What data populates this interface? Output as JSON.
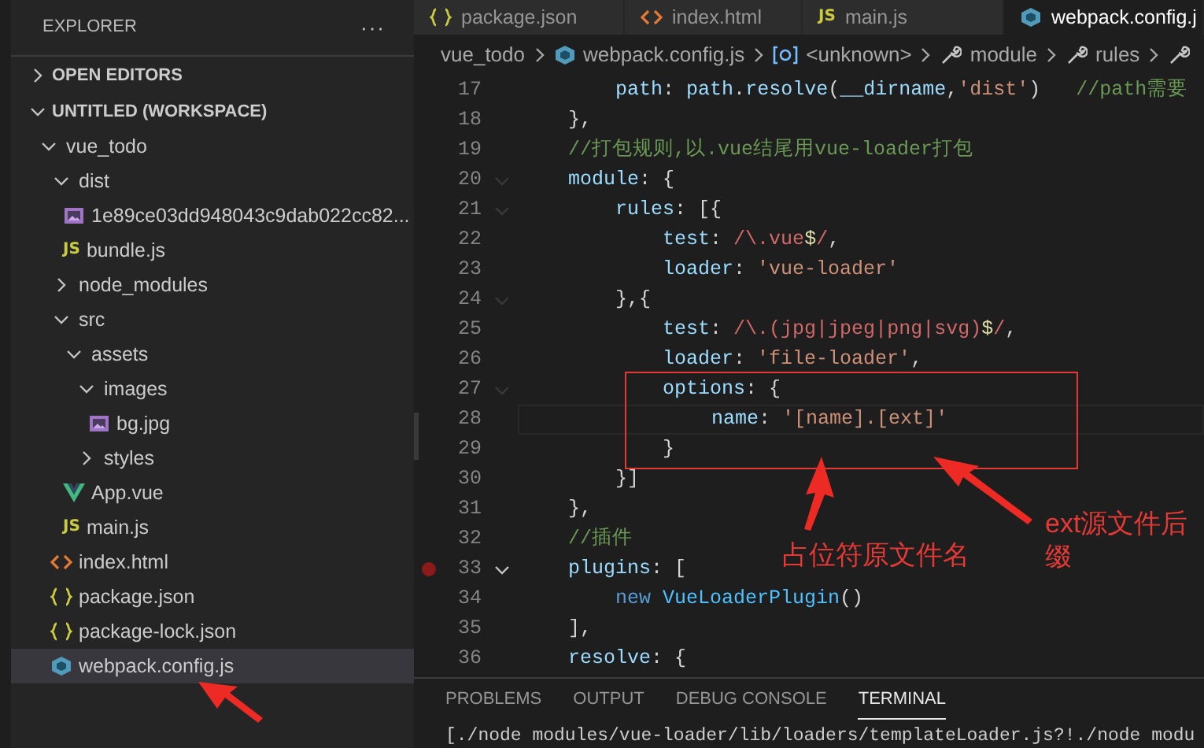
{
  "sidebar": {
    "title": "EXPLORER",
    "more": "···",
    "sections": [
      {
        "label": "OPEN EDITORS",
        "expanded": false
      },
      {
        "label": "UNTITLED (WORKSPACE)",
        "expanded": true
      }
    ],
    "tree": [
      {
        "name": "vue_todo",
        "kind": "folder",
        "expanded": true,
        "selected": false,
        "children": [
          {
            "name": "dist",
            "kind": "folder",
            "expanded": true,
            "selected": false,
            "children": [
              {
                "name": "1e89ce03dd948043c9dab022cc82...",
                "kind": "image",
                "selected": false
              },
              {
                "name": "bundle.js",
                "kind": "js",
                "icon_text": "JS",
                "selected": false
              }
            ]
          },
          {
            "name": "node_modules",
            "kind": "folder",
            "expanded": false,
            "selected": false
          },
          {
            "name": "src",
            "kind": "folder",
            "expanded": true,
            "selected": false,
            "children": [
              {
                "name": "assets",
                "kind": "folder",
                "expanded": true,
                "selected": false,
                "children": [
                  {
                    "name": "images",
                    "kind": "folder",
                    "expanded": true,
                    "selected": false,
                    "children": [
                      {
                        "name": "bg.jpg",
                        "kind": "image",
                        "selected": false
                      }
                    ]
                  },
                  {
                    "name": "styles",
                    "kind": "folder",
                    "expanded": false,
                    "selected": false
                  }
                ]
              },
              {
                "name": "App.vue",
                "kind": "vue",
                "selected": false
              },
              {
                "name": "main.js",
                "kind": "js",
                "icon_text": "JS",
                "selected": false
              }
            ]
          },
          {
            "name": "index.html",
            "kind": "html",
            "selected": false
          },
          {
            "name": "package.json",
            "kind": "json",
            "selected": false
          },
          {
            "name": "package-lock.json",
            "kind": "json",
            "selected": false
          },
          {
            "name": "webpack.config.js",
            "kind": "webpack",
            "selected": true
          }
        ]
      }
    ]
  },
  "tabs": [
    {
      "label": "package.json",
      "kind": "json",
      "selected": false
    },
    {
      "label": "index.html",
      "kind": "html",
      "selected": false
    },
    {
      "label": "main.js",
      "kind": "js",
      "icon_text": "JS",
      "selected": false
    },
    {
      "label": "webpack.config.j",
      "kind": "webpack",
      "selected": true
    }
  ],
  "breadcrumb": [
    {
      "label": "vue_todo",
      "kind": "folder"
    },
    {
      "label": "webpack.config.js",
      "kind": "webpack"
    },
    {
      "label": "<unknown>",
      "kind": "symbol"
    },
    {
      "label": "module",
      "kind": "property"
    },
    {
      "label": "rules",
      "kind": "property"
    },
    {
      "kind": "property"
    }
  ],
  "code_lines": [
    {
      "number": "17",
      "fold_arrow": false,
      "breakpoint": false,
      "current": false,
      "tokens": [
        {
          "kind": "key",
          "text": "        path"
        },
        {
          "kind": "punct",
          "text": ": "
        },
        {
          "kind": "key",
          "text": "path"
        },
        {
          "kind": "punct",
          "text": "."
        },
        {
          "kind": "key",
          "text": "resolve"
        },
        {
          "kind": "punct",
          "text": "("
        },
        {
          "kind": "key",
          "text": "__dirname"
        },
        {
          "kind": "punct",
          "text": ","
        },
        {
          "kind": "string",
          "text": "'dist'"
        },
        {
          "kind": "punct",
          "text": ")   "
        },
        {
          "kind": "comment",
          "text": "//path需要"
        }
      ]
    },
    {
      "number": "18",
      "fold_arrow": false,
      "breakpoint": false,
      "current": false,
      "tokens": [
        {
          "kind": "punct",
          "text": "    },"
        }
      ]
    },
    {
      "number": "19",
      "fold_arrow": false,
      "breakpoint": false,
      "current": false,
      "tokens": [
        {
          "kind": "comment",
          "text": "    //打包规则,以.vue结尾用vue-loader打包"
        }
      ]
    },
    {
      "number": "20",
      "fold_arrow": true,
      "breakpoint": false,
      "current": false,
      "tokens": [
        {
          "kind": "key",
          "text": "    module"
        },
        {
          "kind": "punct",
          "text": ": {"
        }
      ]
    },
    {
      "number": "21",
      "fold_arrow": true,
      "breakpoint": false,
      "current": false,
      "tokens": [
        {
          "kind": "key",
          "text": "        rules"
        },
        {
          "kind": "punct",
          "text": ": [{"
        }
      ]
    },
    {
      "number": "22",
      "fold_arrow": false,
      "breakpoint": false,
      "current": false,
      "tokens": [
        {
          "kind": "key",
          "text": "            test"
        },
        {
          "kind": "punct",
          "text": ": "
        },
        {
          "kind": "regex",
          "text": "/\\.vue"
        },
        {
          "kind": "anchor",
          "text": "$"
        },
        {
          "kind": "regex",
          "text": "/"
        },
        {
          "kind": "punct",
          "text": ","
        }
      ]
    },
    {
      "number": "23",
      "fold_arrow": false,
      "breakpoint": false,
      "current": false,
      "tokens": [
        {
          "kind": "key",
          "text": "            loader"
        },
        {
          "kind": "punct",
          "text": ": "
        },
        {
          "kind": "string",
          "text": "'vue-loader'"
        }
      ]
    },
    {
      "number": "24",
      "fold_arrow": true,
      "breakpoint": false,
      "current": false,
      "tokens": [
        {
          "kind": "punct",
          "text": "        },{"
        }
      ]
    },
    {
      "number": "25",
      "fold_arrow": false,
      "breakpoint": false,
      "current": false,
      "tokens": [
        {
          "kind": "key",
          "text": "            test"
        },
        {
          "kind": "punct",
          "text": ": "
        },
        {
          "kind": "regex",
          "text": "/\\.(jpg|jpeg|png|svg)"
        },
        {
          "kind": "anchor",
          "text": "$"
        },
        {
          "kind": "regex",
          "text": "/"
        },
        {
          "kind": "punct",
          "text": ","
        }
      ]
    },
    {
      "number": "26",
      "fold_arrow": false,
      "breakpoint": false,
      "current": false,
      "tokens": [
        {
          "kind": "key",
          "text": "            loader"
        },
        {
          "kind": "punct",
          "text": ": "
        },
        {
          "kind": "string",
          "text": "'file-loader'"
        },
        {
          "kind": "punct",
          "text": ","
        }
      ]
    },
    {
      "number": "27",
      "fold_arrow": true,
      "breakpoint": false,
      "current": false,
      "tokens": [
        {
          "kind": "key",
          "text": "            options"
        },
        {
          "kind": "punct",
          "text": ": {"
        }
      ]
    },
    {
      "number": "28",
      "fold_arrow": false,
      "breakpoint": false,
      "current": true,
      "tokens": [
        {
          "kind": "key",
          "text": "                name"
        },
        {
          "kind": "punct",
          "text": ": "
        },
        {
          "kind": "string",
          "text": "'[name].[ext]'"
        }
      ]
    },
    {
      "number": "29",
      "fold_arrow": false,
      "breakpoint": false,
      "current": false,
      "tokens": [
        {
          "kind": "punct",
          "text": "            }"
        }
      ]
    },
    {
      "number": "30",
      "fold_arrow": false,
      "breakpoint": false,
      "current": false,
      "tokens": [
        {
          "kind": "punct",
          "text": "        }]"
        }
      ]
    },
    {
      "number": "31",
      "fold_arrow": false,
      "breakpoint": false,
      "current": false,
      "tokens": [
        {
          "kind": "punct",
          "text": "    },"
        }
      ]
    },
    {
      "number": "32",
      "fold_arrow": false,
      "breakpoint": false,
      "current": false,
      "tokens": [
        {
          "kind": "comment",
          "text": "    //插件"
        }
      ]
    },
    {
      "number": "33",
      "fold_arrow": true,
      "breakpoint": true,
      "current": false,
      "tokens": [
        {
          "kind": "key",
          "text": "    plugins"
        },
        {
          "kind": "punct",
          "text": ": ["
        }
      ]
    },
    {
      "number": "34",
      "fold_arrow": false,
      "breakpoint": false,
      "current": false,
      "tokens": [
        {
          "kind": "keyword",
          "text": "        new "
        },
        {
          "kind": "class",
          "text": "VueLoaderPlugin"
        },
        {
          "kind": "punct",
          "text": "()"
        }
      ]
    },
    {
      "number": "35",
      "fold_arrow": false,
      "breakpoint": false,
      "current": false,
      "tokens": [
        {
          "kind": "punct",
          "text": "    ],"
        }
      ]
    },
    {
      "number": "36",
      "fold_arrow": false,
      "breakpoint": false,
      "current": false,
      "tokens": [
        {
          "kind": "key",
          "text": "    resolve"
        },
        {
          "kind": "punct",
          "text": ": {"
        }
      ]
    }
  ],
  "annotations": [
    {
      "text": "占位符原文件名"
    },
    {
      "text": "ext源文件后缀"
    }
  ],
  "panel": {
    "tabs": [
      {
        "label": "PROBLEMS",
        "selected": false
      },
      {
        "label": "OUTPUT",
        "selected": false
      },
      {
        "label": "DEBUG CONSOLE",
        "selected": false
      },
      {
        "label": "TERMINAL",
        "selected": true
      }
    ],
    "terminal_line": "[./node modules/vue-loader/lib/loaders/templateLoader.js?!./node modu"
  }
}
